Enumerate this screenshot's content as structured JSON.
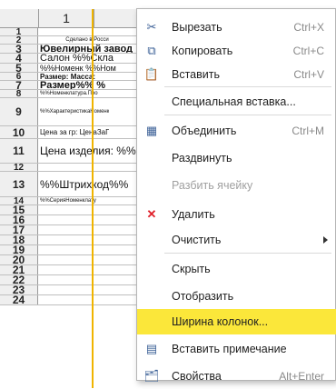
{
  "sheet": {
    "column_header": "1",
    "rows": [
      {
        "n": "1",
        "text": ""
      },
      {
        "n": "2",
        "text": "Сделано в Росси"
      },
      {
        "n": "3",
        "text": "Ювелирный завод"
      },
      {
        "n": "4",
        "text": "Салон %%Скла"
      },
      {
        "n": "5",
        "text": "%%Номенк %%Ном"
      },
      {
        "n": "6",
        "text": "Размер:    Масса:"
      },
      {
        "n": "7",
        "text": "Размер%%        %"
      },
      {
        "n": "8",
        "text": "%%Номенклатура.Про"
      },
      {
        "n": "9",
        "text": "%%ХарактеристикаНоменк"
      },
      {
        "n": "10",
        "text": "Цена за гр:   ЦенаЗаГ"
      },
      {
        "n": "11",
        "text": "Цена изделия:  %%Це"
      },
      {
        "n": "12",
        "text": ""
      },
      {
        "n": "13",
        "text": "%%Штрихкод%%"
      },
      {
        "n": "14",
        "text": "%%СерияНоменклату"
      },
      {
        "n": "15",
        "text": ""
      },
      {
        "n": "16",
        "text": ""
      },
      {
        "n": "17",
        "text": ""
      },
      {
        "n": "18",
        "text": ""
      },
      {
        "n": "19",
        "text": ""
      },
      {
        "n": "20",
        "text": ""
      },
      {
        "n": "21",
        "text": ""
      },
      {
        "n": "22",
        "text": ""
      },
      {
        "n": "23",
        "text": ""
      },
      {
        "n": "24",
        "text": ""
      }
    ]
  },
  "menu": {
    "items": [
      {
        "icon": "scissors-icon",
        "glyph": "✂",
        "label": "Вырезать",
        "shortcut": "Ctrl+X"
      },
      {
        "icon": "copy-icon",
        "glyph": "⧉",
        "label": "Копировать",
        "shortcut": "Ctrl+C"
      },
      {
        "icon": "paste-icon",
        "glyph": "📋",
        "label": "Вставить",
        "shortcut": "Ctrl+V"
      },
      {
        "icon": "",
        "glyph": "",
        "label": "Специальная вставка...",
        "shortcut": ""
      },
      {
        "icon": "merge-cells-icon",
        "glyph": "▦",
        "label": "Объединить",
        "shortcut": "Ctrl+M"
      },
      {
        "icon": "",
        "glyph": "",
        "label": "Раздвинуть",
        "shortcut": ""
      },
      {
        "icon": "",
        "glyph": "",
        "label": "Разбить ячейку",
        "shortcut": ""
      },
      {
        "icon": "delete-icon",
        "glyph": "✕",
        "label": "Удалить",
        "shortcut": ""
      },
      {
        "icon": "",
        "glyph": "",
        "label": "Очистить",
        "shortcut": ""
      },
      {
        "icon": "",
        "glyph": "",
        "label": "Скрыть",
        "shortcut": ""
      },
      {
        "icon": "",
        "glyph": "",
        "label": "Отобразить",
        "shortcut": ""
      },
      {
        "icon": "",
        "glyph": "",
        "label": "Ширина колонок...",
        "shortcut": ""
      },
      {
        "icon": "insert-note-icon",
        "glyph": "▤",
        "label": "Вставить примечание",
        "shortcut": ""
      },
      {
        "icon": "properties-icon",
        "glyph": "🗂",
        "label": "Свойства",
        "shortcut": "Alt+Enter"
      }
    ],
    "highlight_color": "#fbe73a",
    "delete_icon_color": "#e0202a"
  }
}
